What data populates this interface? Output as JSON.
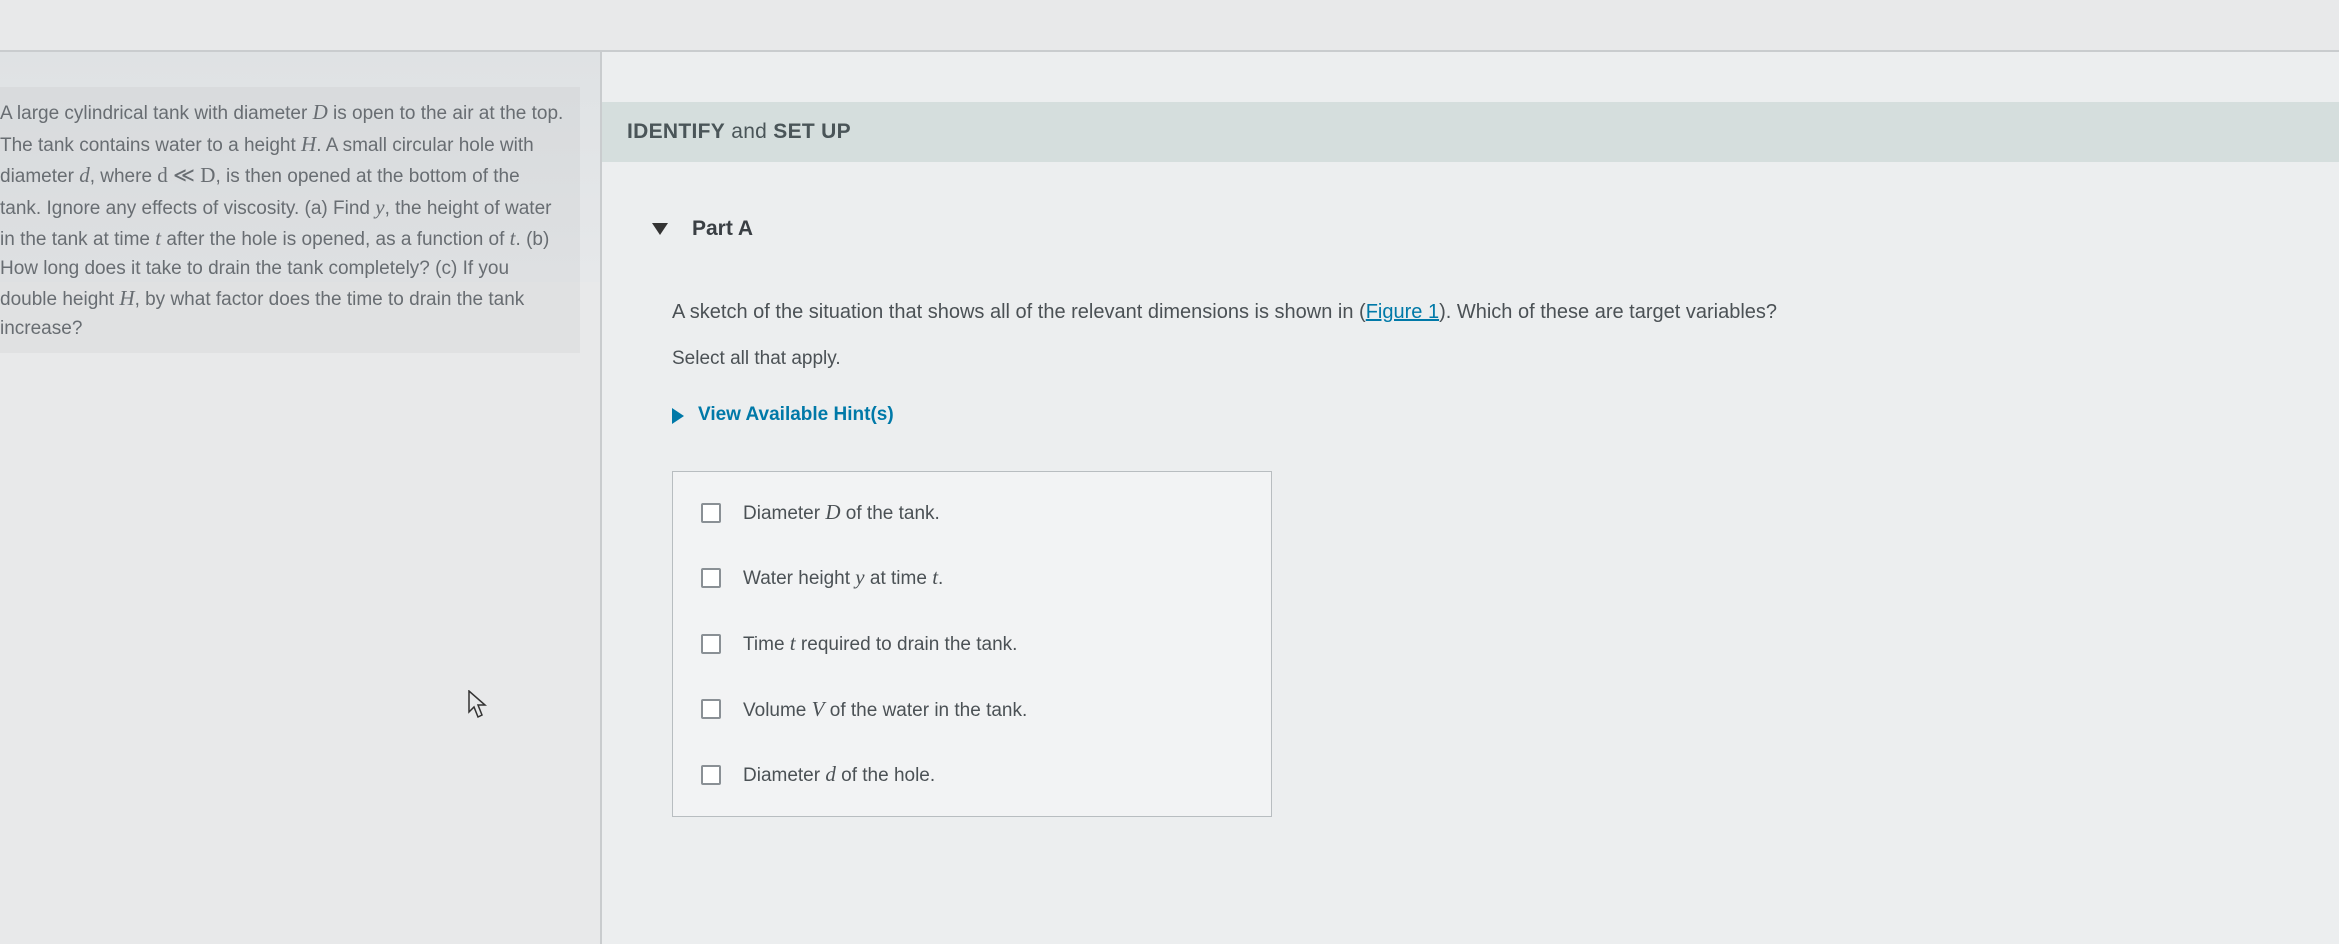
{
  "problem": {
    "text_parts": [
      "A large cylindrical tank with diameter ",
      " is open to the air at the top. The tank contains water to a height ",
      ". A small circular hole with diameter ",
      ", where ",
      ", is then opened at the bottom of the tank. Ignore any effects of viscosity. (a) Find ",
      ", the height of water in the tank at time ",
      " after the hole is opened, as a function of ",
      ". (b) How long does it take to drain the tank completely? (c) If you double height ",
      ", by what factor does the time to drain the tank increase?"
    ],
    "sym_D": "D",
    "sym_H": "H",
    "sym_d": "d",
    "rel": "d ≪ D",
    "sym_y": "y",
    "sym_t": "t",
    "sym_t2": "t",
    "sym_H2": "H"
  },
  "section": {
    "label_a": "IDENTIFY",
    "label_join": " and ",
    "label_b": "SET UP"
  },
  "part": {
    "label": "Part A"
  },
  "question": {
    "pre": "A sketch of the situation that shows all of the relevant dimensions is shown in (",
    "fig": "Figure 1",
    "post": "). Which of these are target variables?",
    "instruction": "Select all that apply.",
    "hints": "View Available Hint(s)"
  },
  "options": [
    {
      "pre": "Diameter ",
      "var": "D",
      "post": " of the tank."
    },
    {
      "pre": "Water height ",
      "var": "y",
      "post": " at time ",
      "var2": "t",
      "post2": "."
    },
    {
      "pre": "Time ",
      "var": "t",
      "post": " required to drain the tank."
    },
    {
      "pre": "Volume ",
      "var": "V",
      "post": " of the water in the tank."
    },
    {
      "pre": "Diameter ",
      "var": "d",
      "post": " of the hole."
    }
  ]
}
